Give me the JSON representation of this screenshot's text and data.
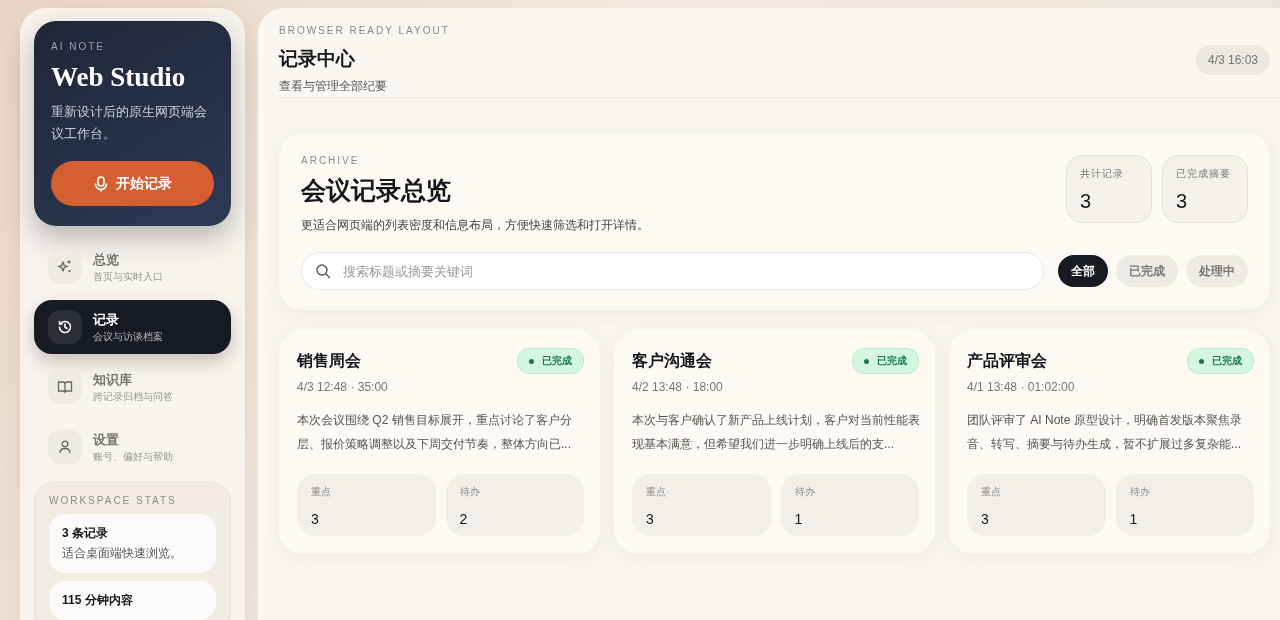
{
  "sidebar": {
    "brand": {
      "eyebrow": "AI NOTE",
      "title": "Web Studio",
      "description": "重新设计后的原生网页端会议工作台。",
      "button": "开始记录"
    },
    "nav": [
      {
        "label": "总览",
        "sublabel": "首页与实时入口",
        "selected": false
      },
      {
        "label": "记录",
        "sublabel": "会议与访谈档案",
        "selected": true
      },
      {
        "label": "知识库",
        "sublabel": "跨记录归档与问答",
        "selected": false
      },
      {
        "label": "设置",
        "sublabel": "账号、偏好与帮助",
        "selected": false
      }
    ],
    "stats": {
      "title": "WORKSPACE STATS",
      "items": [
        {
          "value": "3 条记录",
          "note": "适合桌面端快速浏览。"
        },
        {
          "value": "115 分钟内容"
        }
      ]
    }
  },
  "header": {
    "eyebrow": "BROWSER READY LAYOUT",
    "title": "记录中心",
    "subtitle": "查看与管理全部纪要",
    "time": "4/3 16:03"
  },
  "overview": {
    "eyebrow": "ARCHIVE",
    "title": "会议记录总览",
    "description": "更适合网页端的列表密度和信息布局，方便快速筛选和打开详情。",
    "counters": [
      {
        "label": "共计记录",
        "value": "3"
      },
      {
        "label": "已完成摘要",
        "value": "3"
      }
    ],
    "search": {
      "placeholder": "搜索标题或摘要关键词"
    },
    "filters": [
      {
        "label": "全部",
        "selected": true
      },
      {
        "label": "已完成",
        "selected": false
      },
      {
        "label": "处理中",
        "selected": false
      }
    ]
  },
  "records": [
    {
      "title": "销售周会",
      "status": "已完成",
      "done": true,
      "meta": "4/3 12:48 · 35:00",
      "summary": "本次会议围绕 Q2 销售目标展开，重点讨论了客户分层、报价策略调整以及下周交付节奏，整体方向已...",
      "metrics": [
        {
          "label": "重点",
          "value": "3"
        },
        {
          "label": "待办",
          "value": "2"
        }
      ]
    },
    {
      "title": "客户沟通会",
      "status": "已完成",
      "done": true,
      "meta": "4/2 13:48 · 18:00",
      "summary": "本次与客户确认了新产品上线计划，客户对当前性能表现基本满意，但希望我们进一步明确上线后的支...",
      "metrics": [
        {
          "label": "重点",
          "value": "3"
        },
        {
          "label": "待办",
          "value": "1"
        }
      ]
    },
    {
      "title": "产品评审会",
      "status": "已完成",
      "done": true,
      "meta": "4/1 13:48 · 01:02:00",
      "summary": "团队评审了 AI Note 原型设计，明确首发版本聚焦录音、转写、摘要与待办生成，暂不扩展过多复杂能...",
      "metrics": [
        {
          "label": "重点",
          "value": "3"
        },
        {
          "label": "待办",
          "value": "1"
        }
      ]
    }
  ]
}
